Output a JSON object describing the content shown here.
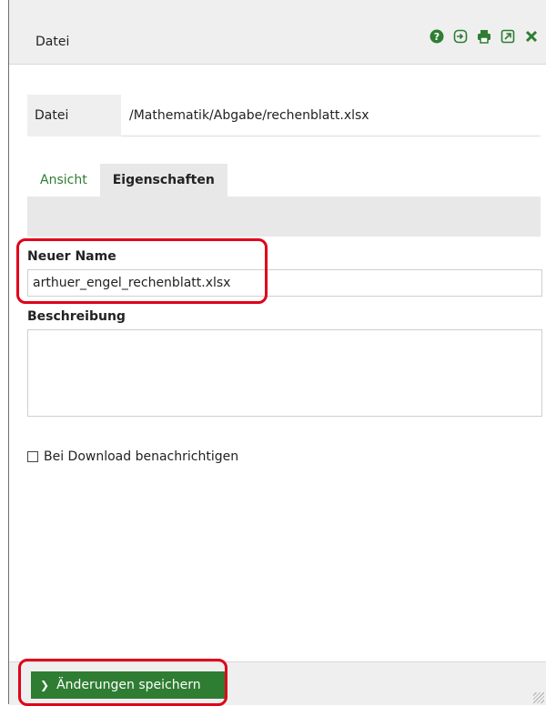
{
  "window": {
    "title": "Datei"
  },
  "file": {
    "label": "Datei",
    "path": "/Mathematik/Abgabe/rechenblatt.xlsx"
  },
  "tabs": [
    {
      "label": "Ansicht",
      "active": false
    },
    {
      "label": "Eigenschaften",
      "active": true
    }
  ],
  "form": {
    "new_name_label": "Neuer Name",
    "new_name_value": "arthuer_engel_rechenblatt.xlsx",
    "description_label": "Beschreibung",
    "description_value": "",
    "notify_label": "Bei Download benachrichtigen",
    "notify_checked": false
  },
  "footer": {
    "save_label": "Änderungen speichern"
  },
  "colors": {
    "accent": "#2e7d32",
    "highlight": "#e0001a"
  },
  "toolbar_icons": [
    "help-icon",
    "sign-in-icon",
    "print-icon",
    "external-link-icon",
    "close-icon"
  ]
}
